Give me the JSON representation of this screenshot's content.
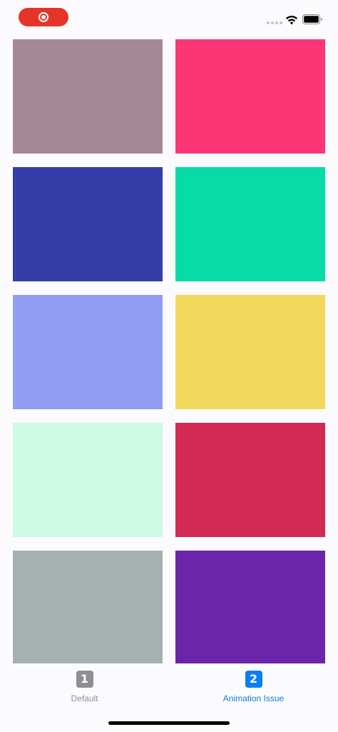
{
  "status_bar": {
    "record_color": "#e5352b",
    "signal_icon": "cellular-signal-icon",
    "wifi_icon": "wifi-icon",
    "battery_icon": "battery-icon"
  },
  "tiles": [
    {
      "color": "#a58795"
    },
    {
      "color": "#fc3676"
    },
    {
      "color": "#333ea8"
    },
    {
      "color": "#07dca8"
    },
    {
      "color": "#8f9ef2"
    },
    {
      "color": "#f2d95d"
    },
    {
      "color": "#cefae3"
    },
    {
      "color": "#d22a54"
    },
    {
      "color": "#a4b1ae"
    },
    {
      "color": "#6b25aa"
    }
  ],
  "tab_bar": {
    "tabs": [
      {
        "icon_text": "1",
        "label": "Default",
        "selected": false,
        "icon_color": "#8e8e93",
        "label_color": "#8e8e93"
      },
      {
        "icon_text": "2",
        "label": "Animation Issue",
        "selected": true,
        "icon_color": "#0a7ff5",
        "label_color": "#1479d2"
      }
    ]
  }
}
